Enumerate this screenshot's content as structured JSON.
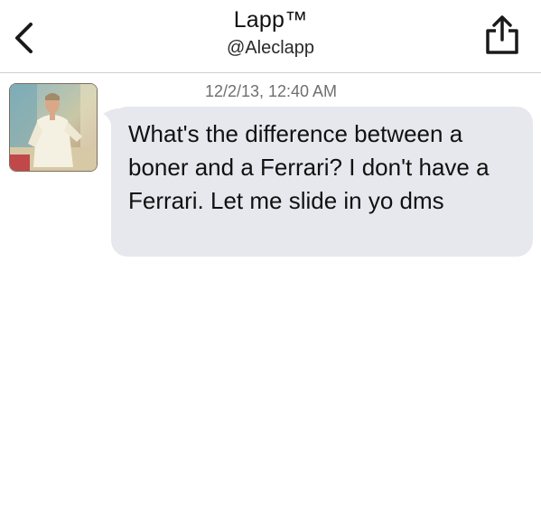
{
  "header": {
    "title": "Lapp™",
    "handle": "@Aleclapp",
    "back_icon": "chevron-left-icon",
    "share_icon": "share-icon"
  },
  "message": {
    "timestamp": "12/2/13, 12:40 AM",
    "text": "What's the difference between a boner and a Ferrari? I don't have a Ferrari. Let me slide in yo dms",
    "bubble_color": "#e6e8ed"
  },
  "colors": {
    "background": "#ffffff",
    "divider": "#cfcfcf",
    "text": "#111111",
    "timestamp": "#6f6f6f"
  }
}
